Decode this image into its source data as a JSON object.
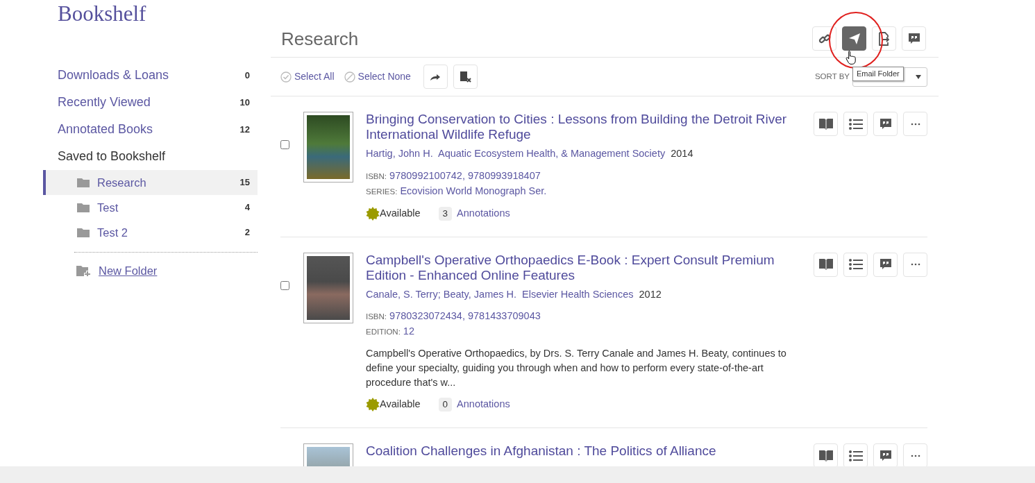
{
  "header": {
    "title": "Bookshelf"
  },
  "sidebar": {
    "items": [
      {
        "label": "Downloads & Loans",
        "count": "0",
        "selected": false
      },
      {
        "label": "Recently Viewed",
        "count": "10",
        "selected": false
      },
      {
        "label": "Annotated Books",
        "count": "12",
        "selected": false
      },
      {
        "label": "Saved to Bookshelf",
        "selected": false,
        "children": [
          {
            "label": "Research",
            "count": "15",
            "selected": true
          },
          {
            "label": "Test",
            "count": "4",
            "selected": false
          },
          {
            "label": "Test 2",
            "count": "2",
            "selected": false
          }
        ]
      }
    ],
    "new_folder": "New Folder"
  },
  "main": {
    "title": "Research",
    "actions": [
      {
        "kind": "link",
        "hovered": false
      },
      {
        "kind": "email",
        "hovered": true
      },
      {
        "kind": "export",
        "hovered": false
      },
      {
        "kind": "comment",
        "hovered": false
      }
    ],
    "tooltip": "Email Folder",
    "select_all": "Select All",
    "select_none": "Select None",
    "sort_label": "SORT BY",
    "books": [
      {
        "checked": false,
        "title": "Bringing Conservation to Cities : Lessons from Building the Detroit River International Wildlife Refuge",
        "authors": "Hartig, John H.",
        "publisher": "Aquatic Ecosystem Health, & Management Society",
        "year": "2014",
        "meta": [
          {
            "label": "ISBN:",
            "value": "9780992100742, 9780993918407"
          },
          {
            "label": "SERIES:",
            "value": "Ecovision World Monograph Ser."
          }
        ],
        "status": "Available",
        "annotation_count": "3",
        "annotation_label": "Annotations"
      },
      {
        "checked": false,
        "title": "Campbell's Operative Orthopaedics E-Book : Expert Consult Premium Edition - Enhanced Online Features",
        "authors": "Canale, S. Terry; Beaty, James H.",
        "publisher": "Elsevier Health Sciences",
        "year": "2012",
        "meta": [
          {
            "label": "ISBN:",
            "value": "9780323072434, 9781433709043"
          },
          {
            "label": "EDITION:",
            "value": "12"
          }
        ],
        "description": "Campbell's Operative Orthopaedics, by Drs. S. Terry Canale and James H. Beaty, continues to define your specialty, guiding you through when and how to perform every state-of-the-art procedure that's w...",
        "status": "Available",
        "annotation_count": "0",
        "annotation_label": "Annotations"
      },
      {
        "title": "Coalition Challenges in Afghanistan : The Politics of Alliance"
      }
    ]
  }
}
